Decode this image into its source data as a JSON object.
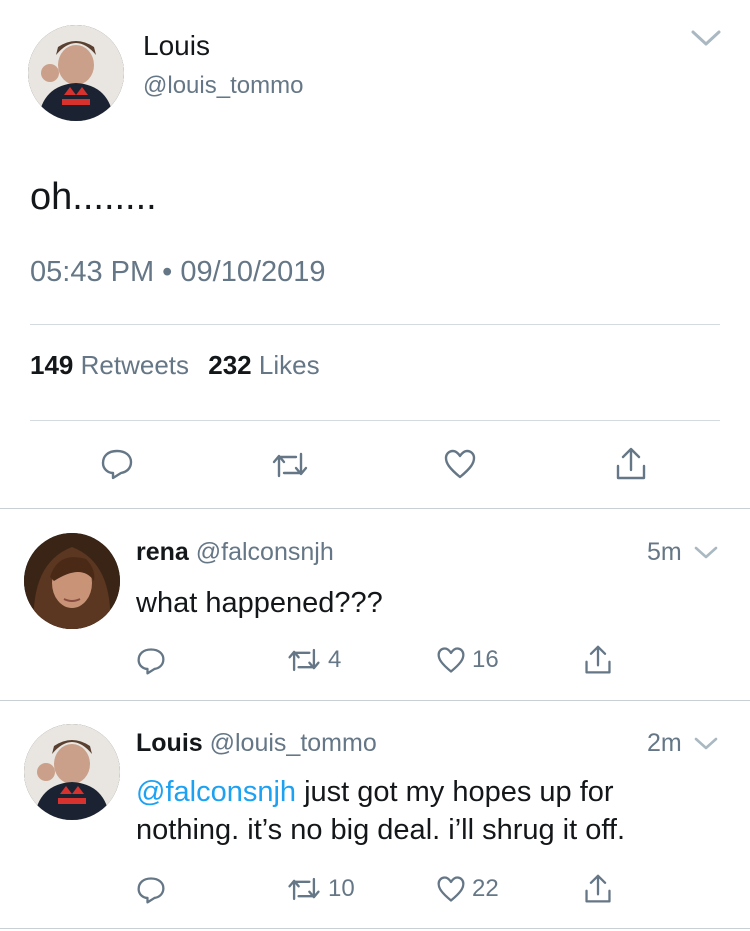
{
  "main_tweet": {
    "name": "Louis",
    "handle": "@louis_tommo",
    "text": "oh........",
    "timestamp": "05:43 PM • 09/10/2019",
    "retweets_count": "149",
    "retweets_label": "Retweets",
    "likes_count": "232",
    "likes_label": "Likes"
  },
  "replies": [
    {
      "name": "rena",
      "handle": "@falconsnjh",
      "time": "5m",
      "text": "what happened???",
      "retweets": "4",
      "likes": "16"
    },
    {
      "name": "Louis",
      "handle": "@louis_tommo",
      "time": "2m",
      "mention": "@falconsnjh",
      "text_line1": " just got my hopes up for",
      "text_line2": "nothing. it’s no big deal. i’ll shrug it off.",
      "retweets": "10",
      "likes": "22"
    }
  ],
  "icons": {
    "reply": "reply-icon",
    "retweet": "retweet-icon",
    "like": "heart-icon",
    "share": "share-icon",
    "more": "chevron-down-icon"
  },
  "colors": {
    "text": "#14171a",
    "secondary": "#657786",
    "link": "#1da1f2",
    "divider": "#d4dbe0"
  }
}
